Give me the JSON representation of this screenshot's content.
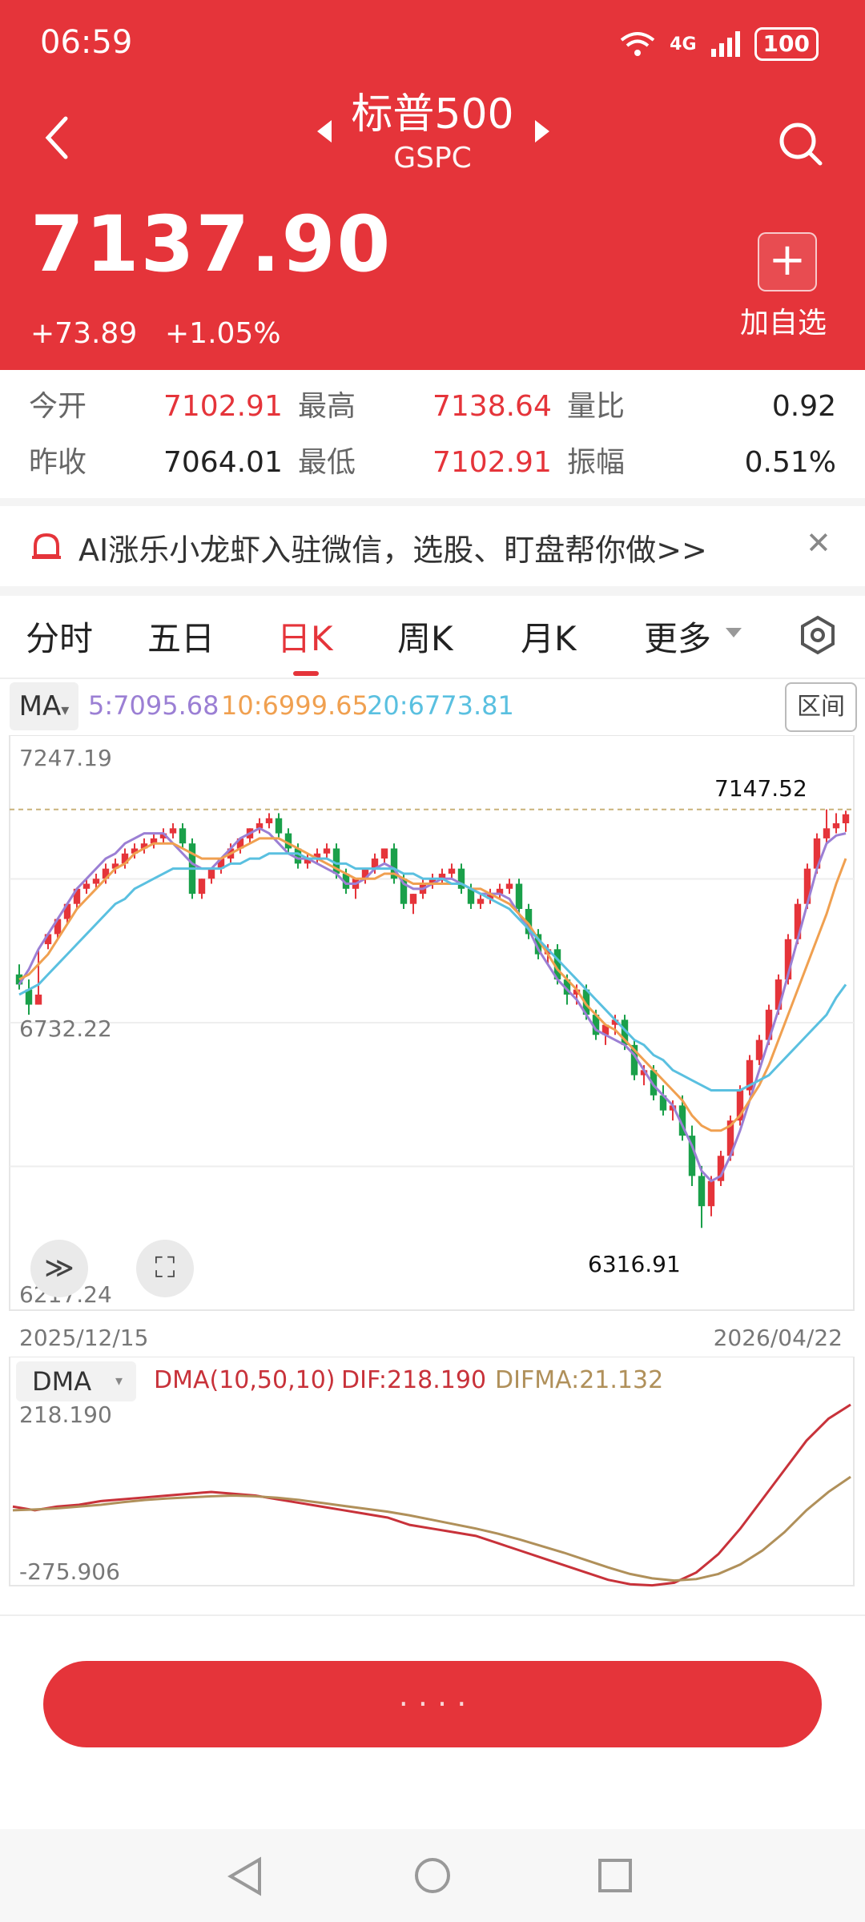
{
  "status": {
    "time": "06:59",
    "network": "4G",
    "battery": "100"
  },
  "header": {
    "title": "标普500",
    "subtitle": "GSPC",
    "price": "7137.90",
    "change": "+73.89",
    "change_pct": "+1.05%",
    "add_label": "加自选",
    "add_symbol": "+"
  },
  "stats": {
    "rows": [
      [
        {
          "label": "今开",
          "value": "7102.91"
        },
        {
          "label": "最高",
          "value": "7138.64"
        },
        {
          "label": "量比",
          "value": "0.92"
        }
      ],
      [
        {
          "label": "昨收",
          "value": "7064.01"
        },
        {
          "label": "最低",
          "value": "7102.91"
        },
        {
          "label": "振幅",
          "value": "0.51%"
        }
      ]
    ]
  },
  "ad": {
    "text": "AI涨乐小龙虾入驻微信，选股、盯盘帮你做>>",
    "close": "✕"
  },
  "tabs": [
    {
      "label": "分时"
    },
    {
      "label": "五日"
    },
    {
      "label": "日K"
    },
    {
      "label": "周K"
    },
    {
      "label": "月K"
    },
    {
      "label": "更多"
    }
  ],
  "active_tab": "日K",
  "indicator": {
    "ma_label": "MA",
    "ma5": "5:7095.68",
    "ma10": "10:6999.65",
    "ma20": "20:6773.81",
    "range_label": "区间"
  },
  "chart": {
    "y_top": "7247.19",
    "y_mid": "6732.22",
    "y_bottom": "6217.24",
    "high_tag": "7147.52",
    "low_tag": "6316.91",
    "date_start": "2025/12/15",
    "date_end": "2026/04/22",
    "more_symbol": "≫",
    "expand_symbol": "⛶"
  },
  "dma": {
    "label": "DMA",
    "params": "DMA(10,50,10)",
    "dif": "DIF:218.190",
    "difma": "DIFMA:21.132",
    "y_top": "218.190",
    "y_bottom": "-275.906"
  },
  "colors": {
    "brand": "#e5343a",
    "up": "#e5343a",
    "down": "#1aa04a",
    "ma5": "#9b7fd4",
    "ma10": "#f0a050",
    "ma20": "#5ac0e0",
    "dif": "#c8323a",
    "difma": "#b0905a"
  },
  "chart_data": {
    "type": "candlestick",
    "title": "标普500 日K",
    "ylim": [
      6217.24,
      7247.19
    ],
    "x_range": [
      "2025/12/15",
      "2026/04/22"
    ],
    "annotations": {
      "high": 7147.52,
      "low": 6316.91
    },
    "ohlc": [
      [
        6820,
        6840,
        6800,
        6790
      ],
      [
        6790,
        6810,
        6760,
        6740
      ],
      [
        6760,
        6870,
        6780,
        6880
      ],
      [
        6880,
        6900,
        6900,
        6870
      ],
      [
        6900,
        6920,
        6930,
        6890
      ],
      [
        6930,
        6950,
        6960,
        6920
      ],
      [
        6960,
        6990,
        6990,
        6950
      ],
      [
        6990,
        7010,
        7000,
        6980
      ],
      [
        7000,
        7020,
        7010,
        6990
      ],
      [
        7010,
        7040,
        7030,
        7000
      ],
      [
        7030,
        7050,
        7040,
        7020
      ],
      [
        7040,
        7070,
        7060,
        7030
      ],
      [
        7060,
        7080,
        7070,
        7050
      ],
      [
        7070,
        7090,
        7080,
        7060
      ],
      [
        7080,
        7100,
        7090,
        7070
      ],
      [
        7090,
        7110,
        7100,
        7080
      ],
      [
        7100,
        7120,
        7110,
        7090
      ],
      [
        7110,
        7120,
        7080,
        7070
      ],
      [
        7080,
        7090,
        6980,
        6970
      ],
      [
        6980,
        7000,
        7010,
        6970
      ],
      [
        7010,
        7020,
        7030,
        7000
      ],
      [
        7030,
        7050,
        7050,
        7020
      ],
      [
        7050,
        7080,
        7070,
        7040
      ],
      [
        7070,
        7090,
        7090,
        7060
      ],
      [
        7090,
        7110,
        7110,
        7080
      ],
      [
        7110,
        7130,
        7120,
        7100
      ],
      [
        7120,
        7140,
        7130,
        7110
      ],
      [
        7130,
        7140,
        7100,
        7090
      ],
      [
        7100,
        7110,
        7070,
        7060
      ],
      [
        7070,
        7080,
        7040,
        7030
      ],
      [
        7040,
        7060,
        7050,
        7030
      ],
      [
        7050,
        7070,
        7060,
        7040
      ],
      [
        7060,
        7080,
        7070,
        7050
      ],
      [
        7070,
        7080,
        7020,
        7010
      ],
      [
        7020,
        7030,
        6990,
        6980
      ],
      [
        6990,
        7000,
        7010,
        6970
      ],
      [
        7010,
        7030,
        7030,
        7000
      ],
      [
        7030,
        7060,
        7050,
        7020
      ],
      [
        7050,
        7070,
        7070,
        7040
      ],
      [
        7070,
        7080,
        7010,
        7000
      ],
      [
        7010,
        7020,
        6960,
        6950
      ],
      [
        6960,
        6970,
        6980,
        6940
      ],
      [
        6980,
        7010,
        7000,
        6970
      ],
      [
        7000,
        7020,
        7010,
        6990
      ],
      [
        7010,
        7030,
        7020,
        7000
      ],
      [
        7020,
        7040,
        7030,
        7010
      ],
      [
        7030,
        7040,
        6990,
        6980
      ],
      [
        6990,
        7000,
        6960,
        6950
      ],
      [
        6960,
        6980,
        6970,
        6950
      ],
      [
        6970,
        6990,
        6980,
        6960
      ],
      [
        6980,
        7000,
        6990,
        6970
      ],
      [
        6990,
        7010,
        7000,
        6980
      ],
      [
        7000,
        7010,
        6950,
        6940
      ],
      [
        6950,
        6960,
        6900,
        6890
      ],
      [
        6900,
        6910,
        6860,
        6850
      ],
      [
        6860,
        6880,
        6870,
        6840
      ],
      [
        6870,
        6880,
        6810,
        6800
      ],
      [
        6810,
        6820,
        6780,
        6760
      ],
      [
        6780,
        6800,
        6790,
        6760
      ],
      [
        6790,
        6800,
        6740,
        6730
      ],
      [
        6740,
        6750,
        6700,
        6690
      ],
      [
        6700,
        6710,
        6720,
        6680
      ],
      [
        6720,
        6740,
        6730,
        6700
      ],
      [
        6730,
        6740,
        6680,
        6670
      ],
      [
        6680,
        6690,
        6620,
        6610
      ],
      [
        6620,
        6640,
        6630,
        6600
      ],
      [
        6630,
        6640,
        6580,
        6570
      ],
      [
        6580,
        6600,
        6550,
        6540
      ],
      [
        6550,
        6570,
        6560,
        6530
      ],
      [
        6560,
        6580,
        6500,
        6490
      ],
      [
        6500,
        6520,
        6420,
        6400
      ],
      [
        6420,
        6440,
        6360,
        6316.91
      ],
      [
        6360,
        6420,
        6410,
        6340
      ],
      [
        6410,
        6470,
        6460,
        6400
      ],
      [
        6460,
        6540,
        6530,
        6450
      ],
      [
        6530,
        6600,
        6590,
        6520
      ],
      [
        6590,
        6660,
        6650,
        6580
      ],
      [
        6650,
        6700,
        6690,
        6640
      ],
      [
        6690,
        6760,
        6750,
        6680
      ],
      [
        6750,
        6820,
        6810,
        6740
      ],
      [
        6810,
        6900,
        6890,
        6800
      ],
      [
        6890,
        6970,
        6960,
        6880
      ],
      [
        6960,
        7040,
        7030,
        6950
      ],
      [
        7030,
        7100,
        7090,
        7020
      ],
      [
        7090,
        7147.52,
        7110,
        7080
      ],
      [
        7110,
        7140,
        7120,
        7100
      ],
      [
        7120,
        7145,
        7137.9,
        7102.91
      ]
    ],
    "series": [
      {
        "name": "MA5",
        "values": [
          6800,
          6830,
          6870,
          6900,
          6930,
          6960,
          6990,
          7010,
          7030,
          7050,
          7060,
          7080,
          7090,
          7100,
          7100,
          7100,
          7080,
          7060,
          7040,
          7030,
          7030,
          7050,
          7070,
          7090,
          7100,
          7110,
          7100,
          7080,
          7060,
          7050,
          7050,
          7040,
          7030,
          7020,
          7000,
          7000,
          7010,
          7030,
          7040,
          7030,
          7000,
          6990,
          6990,
          7000,
          7010,
          7010,
          7000,
          6990,
          6980,
          6980,
          6980,
          6970,
          6940,
          6910,
          6870,
          6840,
          6810,
          6790,
          6770,
          6740,
          6710,
          6700,
          6690,
          6680,
          6660,
          6630,
          6600,
          6580,
          6560,
          6520,
          6480,
          6430,
          6410,
          6420,
          6460,
          6510,
          6570,
          6630,
          6690,
          6750,
          6820,
          6890,
          6960,
          7030,
          7080,
          7095.68,
          7100
        ]
      },
      {
        "name": "MA10",
        "values": [
          6810,
          6820,
          6840,
          6860,
          6890,
          6920,
          6950,
          6970,
          6990,
          7010,
          7030,
          7040,
          7060,
          7070,
          7080,
          7080,
          7080,
          7070,
          7060,
          7050,
          7050,
          7050,
          7060,
          7070,
          7080,
          7090,
          7090,
          7090,
          7080,
          7070,
          7060,
          7050,
          7040,
          7030,
          7020,
          7010,
          7010,
          7010,
          7020,
          7020,
          7010,
          7000,
          7000,
          7000,
          7000,
          7000,
          7000,
          6990,
          6990,
          6980,
          6970,
          6960,
          6940,
          6920,
          6890,
          6860,
          6830,
          6810,
          6790,
          6760,
          6740,
          6720,
          6710,
          6690,
          6670,
          6650,
          6630,
          6610,
          6590,
          6570,
          6540,
          6520,
          6510,
          6510,
          6520,
          6540,
          6570,
          6600,
          6640,
          6690,
          6740,
          6790,
          6840,
          6890,
          6940,
          6999.65,
          7050
        ]
      },
      {
        "name": "MA20",
        "values": [
          6780,
          6790,
          6800,
          6820,
          6840,
          6860,
          6880,
          6900,
          6920,
          6940,
          6960,
          6970,
          6990,
          7000,
          7010,
          7020,
          7030,
          7030,
          7030,
          7030,
          7030,
          7030,
          7040,
          7040,
          7050,
          7050,
          7060,
          7060,
          7060,
          7060,
          7050,
          7050,
          7050,
          7040,
          7040,
          7030,
          7030,
          7030,
          7030,
          7030,
          7020,
          7020,
          7010,
          7010,
          7010,
          7000,
          7000,
          6990,
          6980,
          6970,
          6960,
          6950,
          6930,
          6910,
          6890,
          6870,
          6850,
          6830,
          6810,
          6790,
          6770,
          6750,
          6730,
          6710,
          6690,
          6680,
          6660,
          6650,
          6630,
          6620,
          6610,
          6600,
          6590,
          6590,
          6590,
          6590,
          6600,
          6610,
          6620,
          6640,
          6660,
          6680,
          6700,
          6720,
          6740,
          6773.81,
          6800
        ]
      }
    ]
  },
  "dma_data": {
    "type": "line",
    "ylim": [
      -275.906,
      218.19
    ],
    "series": [
      {
        "name": "DIF",
        "values": [
          -60,
          -70,
          -60,
          -55,
          -45,
          -40,
          -35,
          -30,
          -25,
          -20,
          -25,
          -30,
          -40,
          -50,
          -60,
          -70,
          -80,
          -90,
          -110,
          -120,
          -130,
          -140,
          -160,
          -180,
          -200,
          -220,
          -240,
          -260,
          -272,
          -275,
          -268,
          -240,
          -190,
          -120,
          -40,
          40,
          120,
          180,
          218.19
        ]
      },
      {
        "name": "DIFMA",
        "values": [
          -70,
          -68,
          -65,
          -60,
          -55,
          -48,
          -42,
          -38,
          -35,
          -32,
          -30,
          -32,
          -36,
          -42,
          -50,
          -58,
          -66,
          -74,
          -84,
          -96,
          -108,
          -120,
          -134,
          -150,
          -168,
          -186,
          -206,
          -226,
          -244,
          -256,
          -262,
          -258,
          -244,
          -218,
          -180,
          -130,
          -70,
          -20,
          21.132
        ]
      }
    ]
  }
}
